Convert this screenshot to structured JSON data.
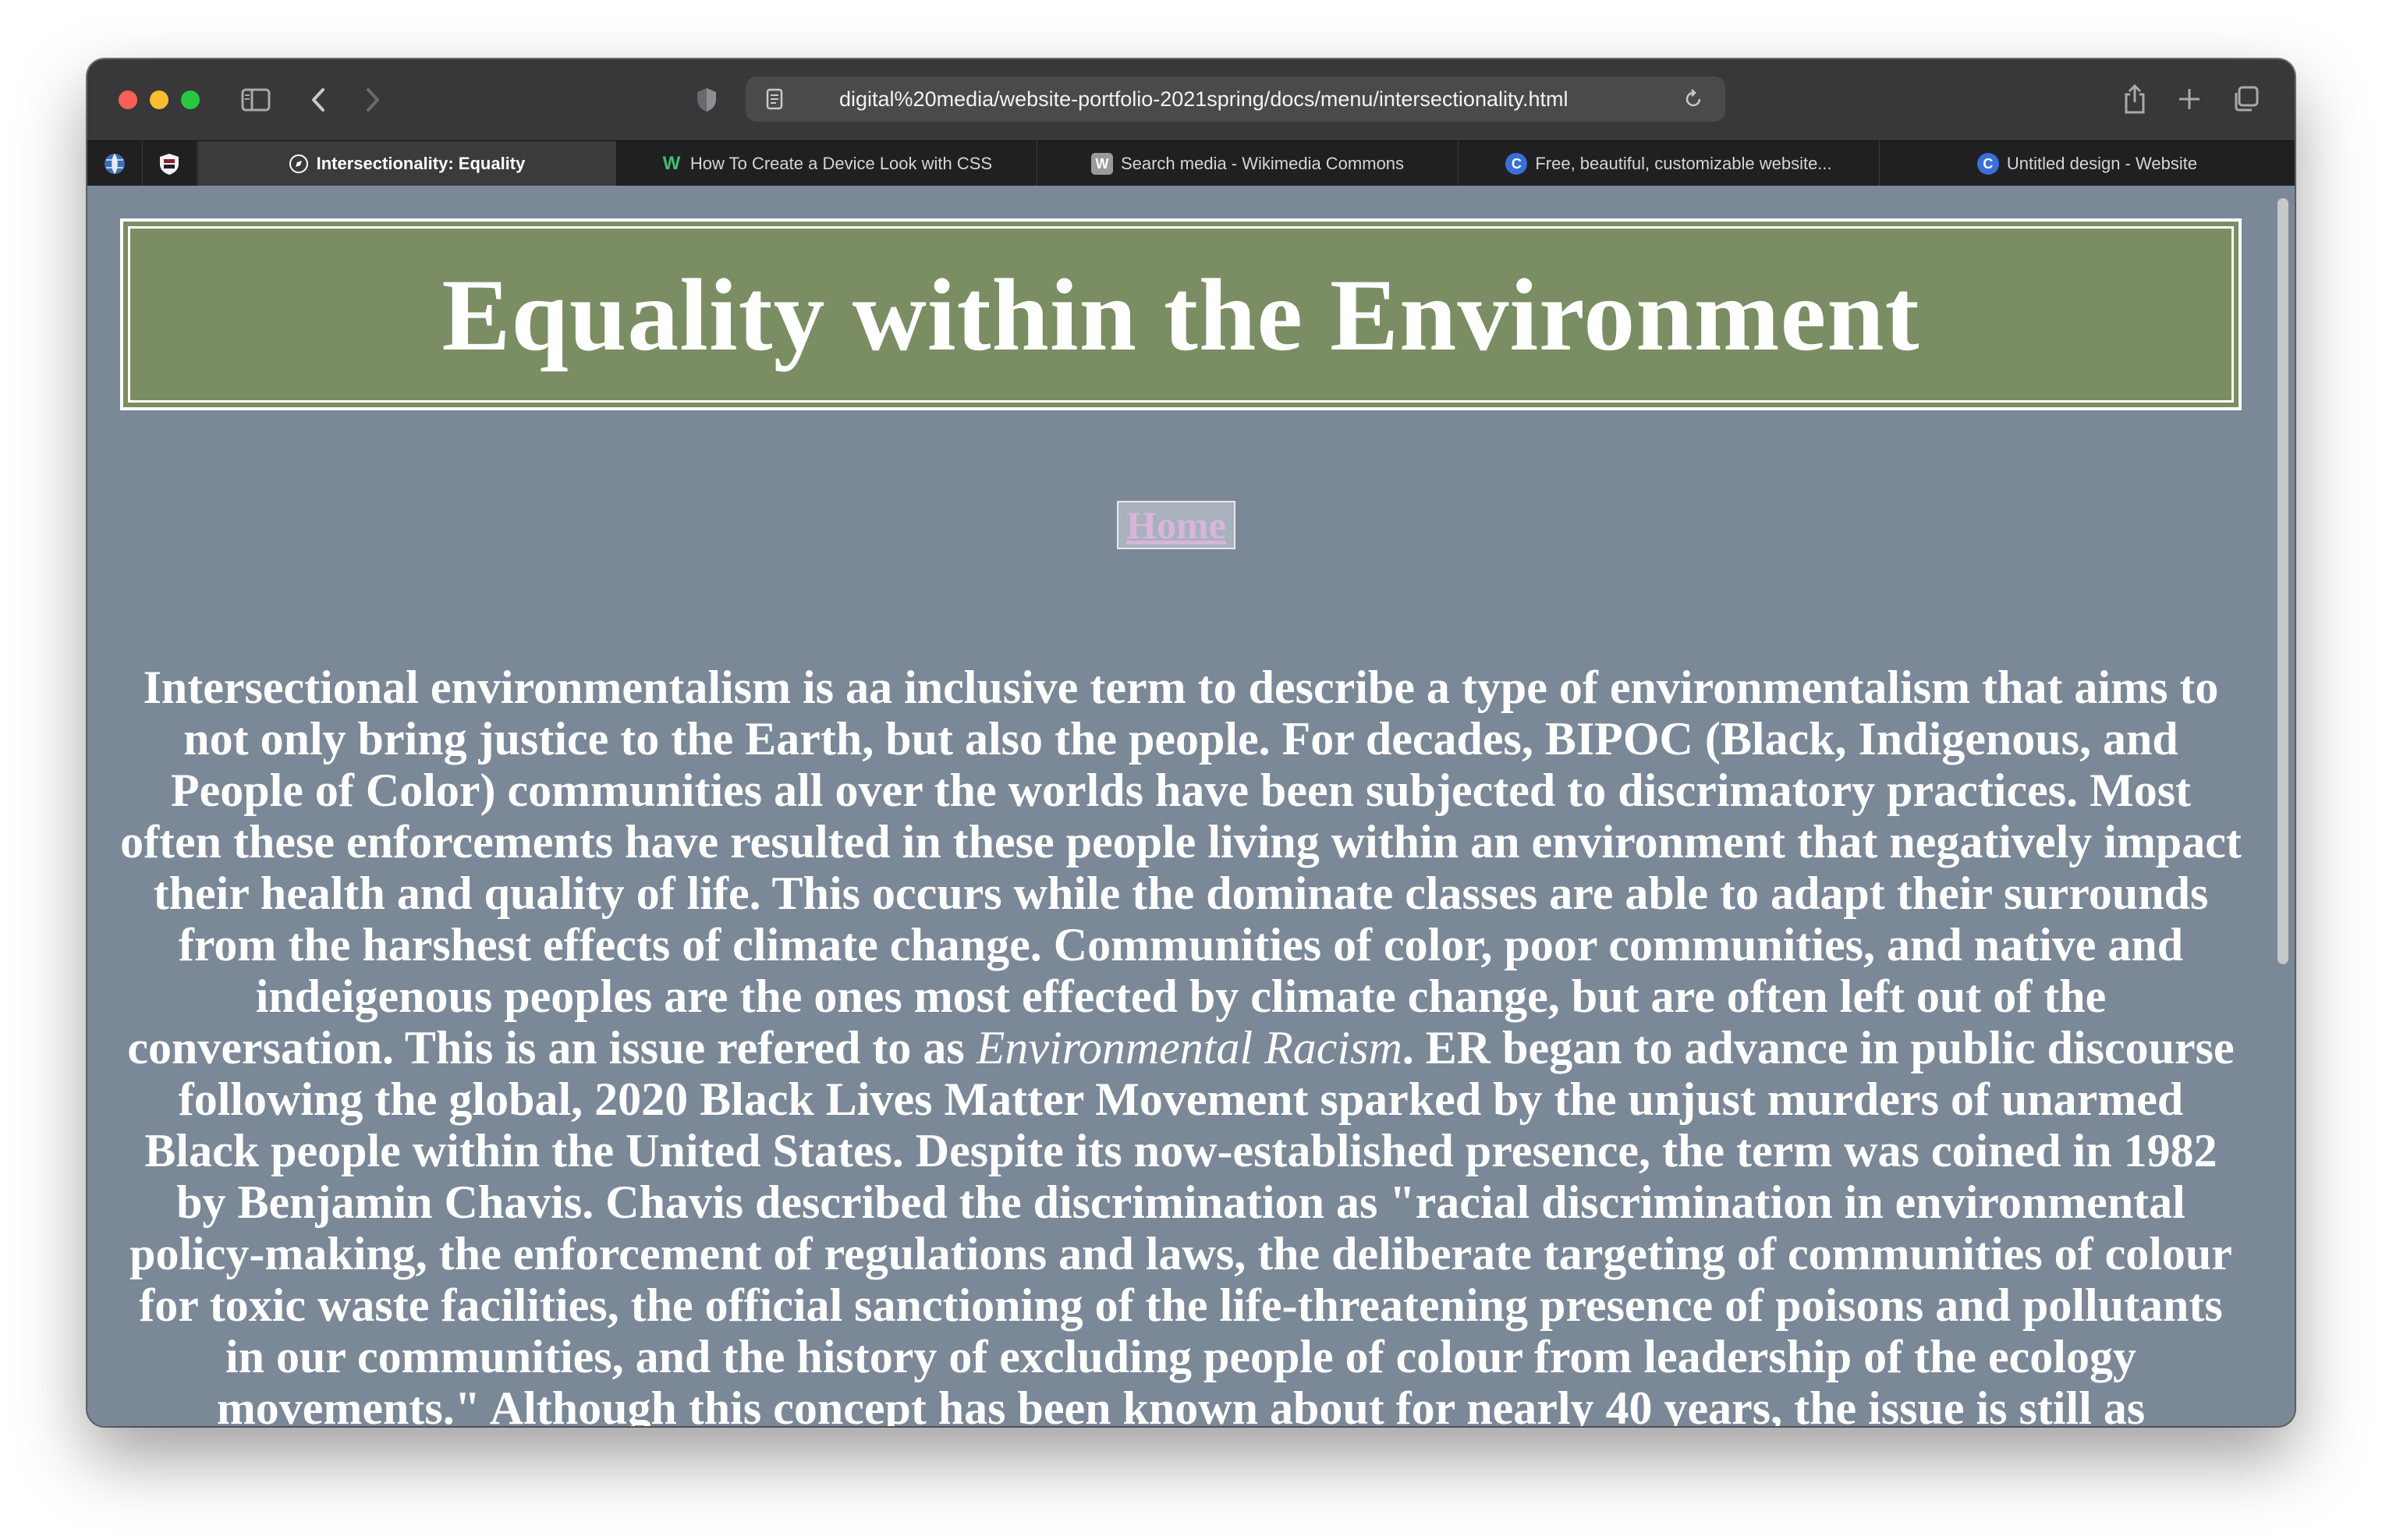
{
  "browser": {
    "url": "digital%20media/website-portfolio-2021spring/docs/menu/intersectionality.html",
    "tabs": [
      {
        "label": "Intersectionality: Equality",
        "icon": "compass-icon",
        "active": true
      },
      {
        "label": "How To Create a Device Look with CSS",
        "icon": "w-logo-icon",
        "active": false
      },
      {
        "label": "Search media - Wikimedia Commons",
        "icon": "wikimedia-icon",
        "active": false
      },
      {
        "label": "Free, beautiful, customizable website...",
        "icon": "canva-icon",
        "active": false
      },
      {
        "label": "Untitled design - Website",
        "icon": "canva-icon",
        "active": false
      }
    ],
    "pinned": [
      "globe-icon",
      "shield-crest-icon"
    ]
  },
  "page": {
    "title": "Equality within the Environment",
    "home_label": "Home",
    "paragraph_before_em": "Intersectional environmentalism is aa inclusive term to describe a type of environmentalism that aims to not only bring justice to the Earth, but also the people. For decades, BIPOC (Black, Indigenous, and People of Color) communities all over the worlds have been subjected to discrimatory practices. Most often these enforcements have resulted in these people living within an environment that negatively impact their health and quality of life. This occurs while the dominate classes are able to adapt their surrounds from the harshest effects of climate change. Communities of color, poor communities, and native and indeigenous peoples are the ones most effected by climate change, but are often left out of the conversation. This is an issue refered to as",
    "paragraph_em": "Environmental Racism",
    "paragraph_after_em": ". ER began to advance in public discourse following the global, 2020 Black Lives Matter Movement sparked by the unjust murders of unarmed Black people within the United States. Despite its now-established presence, the term was coined in 1982 by Benjamin Chavis. Chavis described the discrimination as \"racial discrimination in environmental policy-making, the enforcement of regulations and laws, the deliberate targeting of communities of colour for toxic waste facilities, the official sanctioning of the life-threatening presence of poisons and pollutants in our communities, and the history of excluding people of colour from leadership of the ecology movements.\" Although this concept has been known about for nearly 40 years, the issue is still as"
  },
  "colors": {
    "page_bg": "#7b8898",
    "banner_bg": "#7b8d63",
    "link": "#d9b5dc"
  }
}
